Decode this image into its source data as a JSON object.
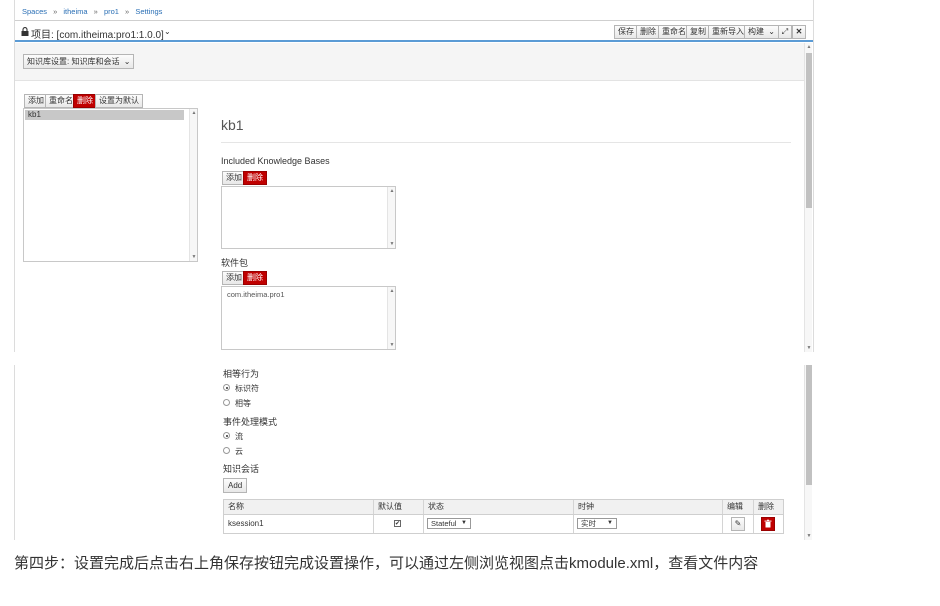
{
  "breadcrumb": {
    "items": [
      "Spaces",
      "itheima",
      "pro1",
      "Settings"
    ],
    "separator": "»"
  },
  "header": {
    "project_label": "项目: [com.itheima:pro1:1.0.0]",
    "toolbar": {
      "save": "保存",
      "delete": "删除",
      "rename": "重命名",
      "copy": "复制",
      "reimport": "重新导入",
      "build": "构建"
    }
  },
  "kbase_settings": {
    "dropdown_label": "知识库设置: 知识库和会话"
  },
  "kb_list": {
    "buttons": {
      "add": "添加",
      "rename": "重命名",
      "delete": "删除",
      "set_default": "设置为默认"
    },
    "items": [
      "kb1"
    ]
  },
  "kb_detail": {
    "title": "kb1",
    "included_kb": {
      "label": "Included Knowledge Bases",
      "add": "添加",
      "delete": "删除",
      "items": []
    },
    "packages": {
      "label": "软件包",
      "add": "添加",
      "delete": "删除",
      "items": [
        "com.itheima.pro1"
      ]
    },
    "equality": {
      "label": "相等行为",
      "options": [
        "标识符",
        "相等"
      ],
      "selected": 0
    },
    "event_mode": {
      "label": "事件处理模式",
      "options": [
        "流",
        "云"
      ],
      "selected": 0
    },
    "sessions": {
      "label": "知识会话",
      "add_button": "Add",
      "columns": [
        "名称",
        "默认值",
        "状态",
        "时钟",
        "编辑",
        "删除"
      ],
      "rows": [
        {
          "name": "ksession1",
          "default": true,
          "state": "Stateful",
          "clock": "实时"
        }
      ]
    }
  },
  "caption": {
    "text": "第四步：设置完成后点击右上角保存按钮完成设置操作，可以通过左侧浏览视图点击kmodule.xml，查看文件内容"
  },
  "colors": {
    "accent_red": "#c00000",
    "link_blue": "#2a6fb5",
    "panel_bg": "#f5f5f5"
  }
}
